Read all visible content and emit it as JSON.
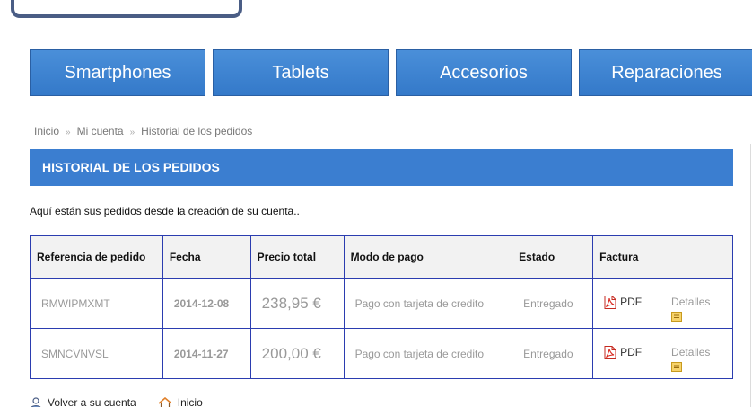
{
  "nav": {
    "items": [
      {
        "label": "Smartphones"
      },
      {
        "label": "Tablets"
      },
      {
        "label": "Accesorios"
      },
      {
        "label": "Reparaciones"
      }
    ]
  },
  "breadcrumb": {
    "home": "Inicio",
    "sep": "»",
    "account": "Mi cuenta",
    "current": "Historial de los pedidos"
  },
  "page": {
    "title": "HISTORIAL DE LOS PEDIDOS",
    "intro": "Aquí están sus pedidos desde la creación de su cuenta.."
  },
  "table": {
    "headers": [
      "Referencia de pedido",
      "Fecha",
      "Precio total",
      "Modo de pago",
      "Estado",
      "Factura",
      ""
    ],
    "rows": [
      {
        "ref": "RMWIPMXMT",
        "date": "2014-12-08",
        "total": "238,95 €",
        "payment": "Pago con tarjeta de credito",
        "status": "Entregado",
        "invoice": "PDF",
        "details": "Detalles"
      },
      {
        "ref": "SMNCVNVSL",
        "date": "2014-11-27",
        "total": "200,00 €",
        "payment": "Pago con tarjeta de credito",
        "status": "Entregado",
        "invoice": "PDF",
        "details": "Detalles"
      }
    ]
  },
  "footer": {
    "back_label": "Volver a su cuenta",
    "home_label": "Inicio"
  },
  "icons": {
    "pdf": "pdf-icon",
    "details": "details-icon",
    "user": "user-icon",
    "home": "home-icon"
  },
  "colors": {
    "nav_blue": "#3b7ed0",
    "title_bar": "#3b7ed0",
    "table_border": "#2b3db0",
    "pdf_red": "#d9261c",
    "home_orange": "#e0802a"
  }
}
